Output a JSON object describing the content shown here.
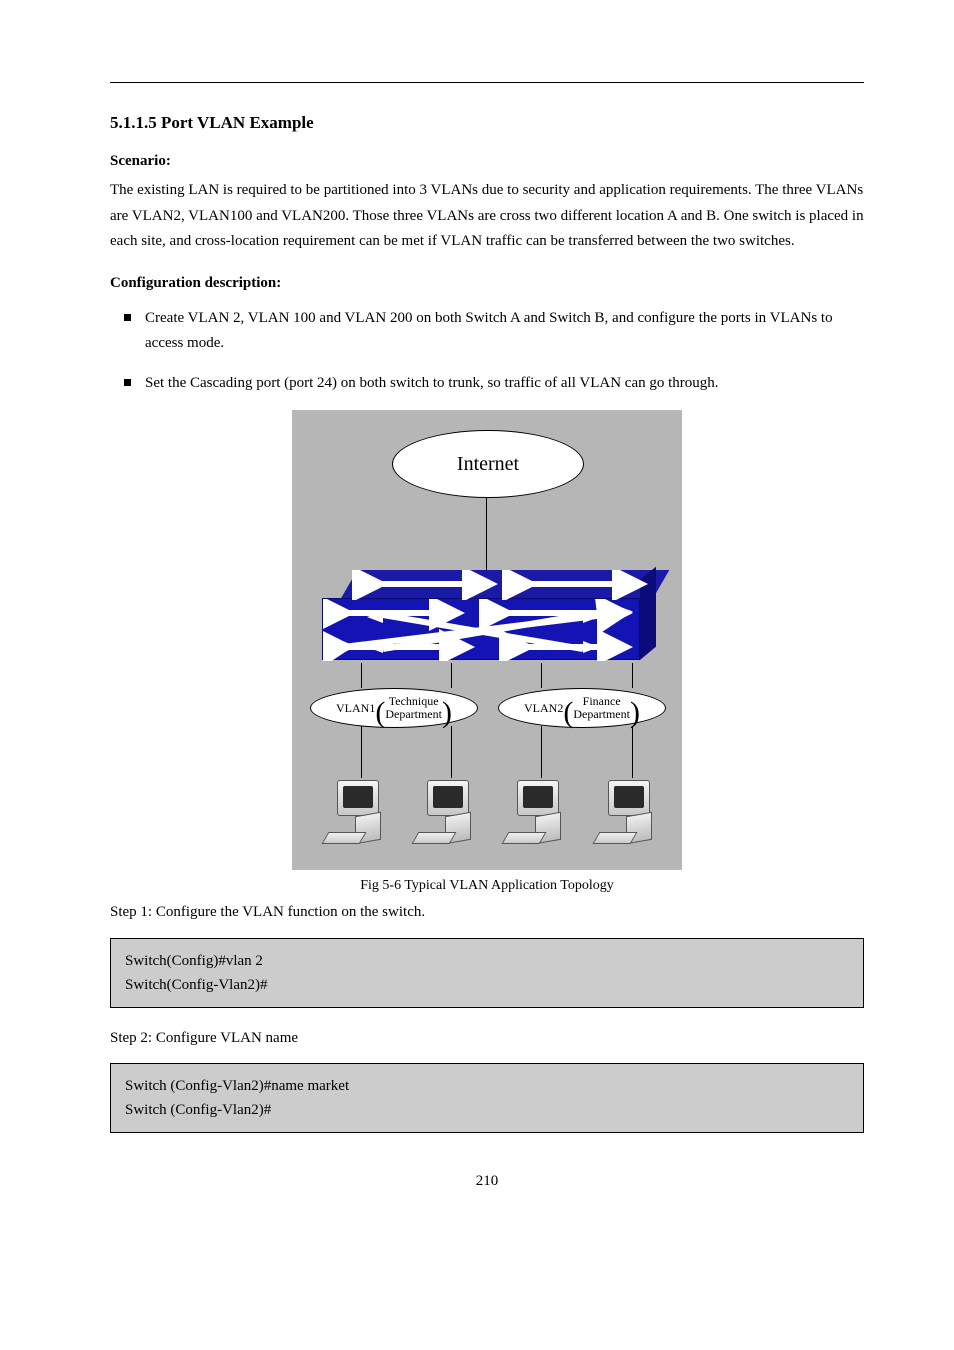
{
  "section_title": "5.1.1.5 Port VLAN Example",
  "scenario_title": "Scenario:",
  "scenario_para": "The existing LAN is required to be partitioned into 3 VLANs due to security and application requirements. The three VLANs are VLAN2, VLAN100 and VLAN200. Those three VLANs are cross two different location A and B. One switch is placed in each site, and cross-location requirement can be met if VLAN traffic can be transferred between the two switches.",
  "config_desc_title": "Configuration description:",
  "bullets": [
    "Create VLAN 2, VLAN 100 and VLAN 200 on both Switch A and Switch B, and configure the ports in VLANs to access mode.",
    "Set the Cascading port (port 24) on both switch to trunk, so traffic of all VLAN can go through."
  ],
  "diagram": {
    "internet": "Internet",
    "vlan1_prefix": "VLAN1",
    "vlan1_line1": "Technique",
    "vlan1_line2": "Department",
    "vlan2_prefix": "VLAN2",
    "vlan2_line1": "Finance",
    "vlan2_line2": "Department"
  },
  "figure_caption": "Fig 5-6 Typical VLAN Application Topology",
  "step1": "Step 1: Configure the VLAN function on the switch.",
  "code1": "Switch(Config)#vlan 2\nSwitch(Config-Vlan2)#",
  "step2": "Step 2: Configure VLAN name",
  "code2": "Switch (Config-Vlan2)#name market\nSwitch (Config-Vlan2)#",
  "page_number": "210"
}
